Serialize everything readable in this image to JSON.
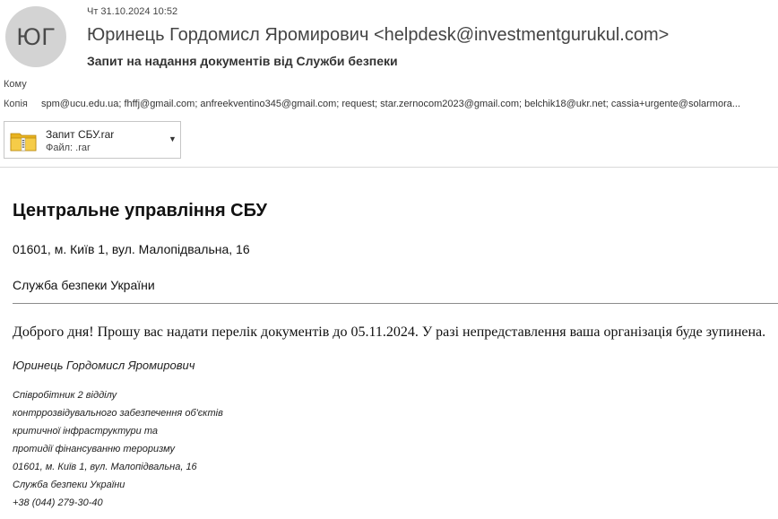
{
  "header": {
    "avatar_initials": "ЮГ",
    "date": "Чт 31.10.2024 10:52",
    "sender": "Юринець Гордомисл Яромирович <helpdesk@investmentgurukul.com>",
    "subject": "Запит на надання документів від Служби безпеки",
    "to_label": "Кому",
    "cc_label": "Копія",
    "cc_value": "spm@ucu.edu.ua; fhffj@gmail.com; anfreekventino345@gmail.com; request; star.zernocom2023@gmail.com; belchik18@ukr.net; cassia+urgente@solarmora..."
  },
  "attachment": {
    "name": "Запит СБУ.rar",
    "type_label": "Файл: .rar",
    "icon": "folder-archive-icon",
    "menu_icon": "chevron-down-icon"
  },
  "body": {
    "org_title": "Центральне управління СБУ",
    "address": "01601, м. Київ 1, вул. Малопідвальна, 16",
    "service": "Служба безпеки України",
    "message": "Доброго дня! Прошу вас надати перелік документів до 05.11.2024. У разі непредставлення ваша організація буде зупинена.",
    "signature_name": "Юринець Гордомисл Яромирович",
    "signature_lines": [
      "Співробітник 2 відділу",
      "контррозвідувального забезпечення об'єктів",
      "критичної інфраструктури та",
      "протидії фінансуванню тероризму",
      "01601, м. Київ 1, вул. Малопідвальна, 16",
      "Служба безпеки України",
      "+38 (044) 279-30-40"
    ]
  },
  "colors": {
    "avatar_bg": "#d3d3d3",
    "folder": "#f2c230",
    "divider": "#d9d9d9"
  }
}
